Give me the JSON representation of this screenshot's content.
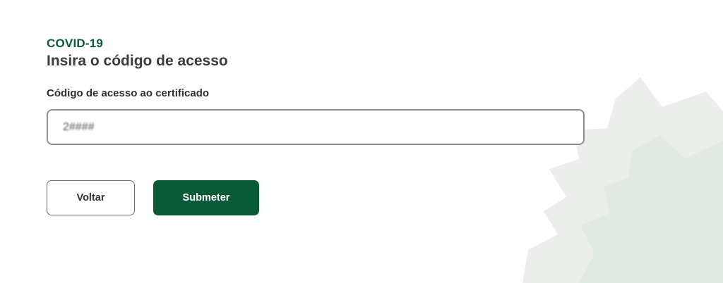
{
  "header": {
    "kicker": "COVID-19",
    "title": "Insira o código de acesso"
  },
  "form": {
    "field_label": "Código de acesso ao certificado",
    "access_code_value": "2####"
  },
  "actions": {
    "back_label": "Voltar",
    "submit_label": "Submeter"
  },
  "colors": {
    "brand_green": "#0b5a37",
    "decor_outer": "#eceeec",
    "decor_inner": "#e1ebe3"
  },
  "icons": {
    "decoration": "starburst-decoration"
  }
}
